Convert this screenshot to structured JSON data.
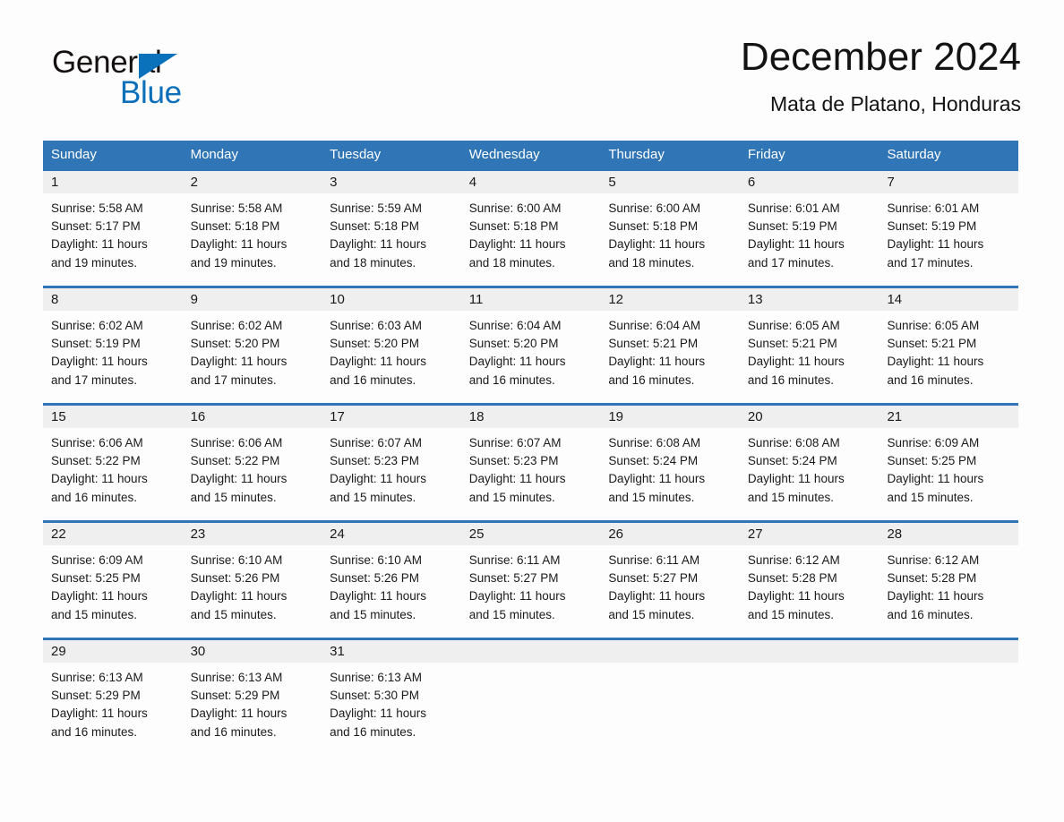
{
  "brand": {
    "name_part1": "General",
    "name_part2": "Blue",
    "logo_icon": "triangle-flag-icon",
    "accent_color": "#0b6fba"
  },
  "header": {
    "title": "December 2024",
    "subtitle": "Mata de Platano, Honduras"
  },
  "theme": {
    "header_bar_color": "#3075b5",
    "day_band_color": "#efefef",
    "page_background": "#fdfdfd"
  },
  "weekdays": [
    "Sunday",
    "Monday",
    "Tuesday",
    "Wednesday",
    "Thursday",
    "Friday",
    "Saturday"
  ],
  "weeks": [
    [
      {
        "day": "1",
        "sunrise": "Sunrise: 5:58 AM",
        "sunset": "Sunset: 5:17 PM",
        "daylight1": "Daylight: 11 hours",
        "daylight2": "and 19 minutes."
      },
      {
        "day": "2",
        "sunrise": "Sunrise: 5:58 AM",
        "sunset": "Sunset: 5:18 PM",
        "daylight1": "Daylight: 11 hours",
        "daylight2": "and 19 minutes."
      },
      {
        "day": "3",
        "sunrise": "Sunrise: 5:59 AM",
        "sunset": "Sunset: 5:18 PM",
        "daylight1": "Daylight: 11 hours",
        "daylight2": "and 18 minutes."
      },
      {
        "day": "4",
        "sunrise": "Sunrise: 6:00 AM",
        "sunset": "Sunset: 5:18 PM",
        "daylight1": "Daylight: 11 hours",
        "daylight2": "and 18 minutes."
      },
      {
        "day": "5",
        "sunrise": "Sunrise: 6:00 AM",
        "sunset": "Sunset: 5:18 PM",
        "daylight1": "Daylight: 11 hours",
        "daylight2": "and 18 minutes."
      },
      {
        "day": "6",
        "sunrise": "Sunrise: 6:01 AM",
        "sunset": "Sunset: 5:19 PM",
        "daylight1": "Daylight: 11 hours",
        "daylight2": "and 17 minutes."
      },
      {
        "day": "7",
        "sunrise": "Sunrise: 6:01 AM",
        "sunset": "Sunset: 5:19 PM",
        "daylight1": "Daylight: 11 hours",
        "daylight2": "and 17 minutes."
      }
    ],
    [
      {
        "day": "8",
        "sunrise": "Sunrise: 6:02 AM",
        "sunset": "Sunset: 5:19 PM",
        "daylight1": "Daylight: 11 hours",
        "daylight2": "and 17 minutes."
      },
      {
        "day": "9",
        "sunrise": "Sunrise: 6:02 AM",
        "sunset": "Sunset: 5:20 PM",
        "daylight1": "Daylight: 11 hours",
        "daylight2": "and 17 minutes."
      },
      {
        "day": "10",
        "sunrise": "Sunrise: 6:03 AM",
        "sunset": "Sunset: 5:20 PM",
        "daylight1": "Daylight: 11 hours",
        "daylight2": "and 16 minutes."
      },
      {
        "day": "11",
        "sunrise": "Sunrise: 6:04 AM",
        "sunset": "Sunset: 5:20 PM",
        "daylight1": "Daylight: 11 hours",
        "daylight2": "and 16 minutes."
      },
      {
        "day": "12",
        "sunrise": "Sunrise: 6:04 AM",
        "sunset": "Sunset: 5:21 PM",
        "daylight1": "Daylight: 11 hours",
        "daylight2": "and 16 minutes."
      },
      {
        "day": "13",
        "sunrise": "Sunrise: 6:05 AM",
        "sunset": "Sunset: 5:21 PM",
        "daylight1": "Daylight: 11 hours",
        "daylight2": "and 16 minutes."
      },
      {
        "day": "14",
        "sunrise": "Sunrise: 6:05 AM",
        "sunset": "Sunset: 5:21 PM",
        "daylight1": "Daylight: 11 hours",
        "daylight2": "and 16 minutes."
      }
    ],
    [
      {
        "day": "15",
        "sunrise": "Sunrise: 6:06 AM",
        "sunset": "Sunset: 5:22 PM",
        "daylight1": "Daylight: 11 hours",
        "daylight2": "and 16 minutes."
      },
      {
        "day": "16",
        "sunrise": "Sunrise: 6:06 AM",
        "sunset": "Sunset: 5:22 PM",
        "daylight1": "Daylight: 11 hours",
        "daylight2": "and 15 minutes."
      },
      {
        "day": "17",
        "sunrise": "Sunrise: 6:07 AM",
        "sunset": "Sunset: 5:23 PM",
        "daylight1": "Daylight: 11 hours",
        "daylight2": "and 15 minutes."
      },
      {
        "day": "18",
        "sunrise": "Sunrise: 6:07 AM",
        "sunset": "Sunset: 5:23 PM",
        "daylight1": "Daylight: 11 hours",
        "daylight2": "and 15 minutes."
      },
      {
        "day": "19",
        "sunrise": "Sunrise: 6:08 AM",
        "sunset": "Sunset: 5:24 PM",
        "daylight1": "Daylight: 11 hours",
        "daylight2": "and 15 minutes."
      },
      {
        "day": "20",
        "sunrise": "Sunrise: 6:08 AM",
        "sunset": "Sunset: 5:24 PM",
        "daylight1": "Daylight: 11 hours",
        "daylight2": "and 15 minutes."
      },
      {
        "day": "21",
        "sunrise": "Sunrise: 6:09 AM",
        "sunset": "Sunset: 5:25 PM",
        "daylight1": "Daylight: 11 hours",
        "daylight2": "and 15 minutes."
      }
    ],
    [
      {
        "day": "22",
        "sunrise": "Sunrise: 6:09 AM",
        "sunset": "Sunset: 5:25 PM",
        "daylight1": "Daylight: 11 hours",
        "daylight2": "and 15 minutes."
      },
      {
        "day": "23",
        "sunrise": "Sunrise: 6:10 AM",
        "sunset": "Sunset: 5:26 PM",
        "daylight1": "Daylight: 11 hours",
        "daylight2": "and 15 minutes."
      },
      {
        "day": "24",
        "sunrise": "Sunrise: 6:10 AM",
        "sunset": "Sunset: 5:26 PM",
        "daylight1": "Daylight: 11 hours",
        "daylight2": "and 15 minutes."
      },
      {
        "day": "25",
        "sunrise": "Sunrise: 6:11 AM",
        "sunset": "Sunset: 5:27 PM",
        "daylight1": "Daylight: 11 hours",
        "daylight2": "and 15 minutes."
      },
      {
        "day": "26",
        "sunrise": "Sunrise: 6:11 AM",
        "sunset": "Sunset: 5:27 PM",
        "daylight1": "Daylight: 11 hours",
        "daylight2": "and 15 minutes."
      },
      {
        "day": "27",
        "sunrise": "Sunrise: 6:12 AM",
        "sunset": "Sunset: 5:28 PM",
        "daylight1": "Daylight: 11 hours",
        "daylight2": "and 15 minutes."
      },
      {
        "day": "28",
        "sunrise": "Sunrise: 6:12 AM",
        "sunset": "Sunset: 5:28 PM",
        "daylight1": "Daylight: 11 hours",
        "daylight2": "and 16 minutes."
      }
    ],
    [
      {
        "day": "29",
        "sunrise": "Sunrise: 6:13 AM",
        "sunset": "Sunset: 5:29 PM",
        "daylight1": "Daylight: 11 hours",
        "daylight2": "and 16 minutes."
      },
      {
        "day": "30",
        "sunrise": "Sunrise: 6:13 AM",
        "sunset": "Sunset: 5:29 PM",
        "daylight1": "Daylight: 11 hours",
        "daylight2": "and 16 minutes."
      },
      {
        "day": "31",
        "sunrise": "Sunrise: 6:13 AM",
        "sunset": "Sunset: 5:30 PM",
        "daylight1": "Daylight: 11 hours",
        "daylight2": "and 16 minutes."
      },
      {
        "day": "",
        "sunrise": "",
        "sunset": "",
        "daylight1": "",
        "daylight2": ""
      },
      {
        "day": "",
        "sunrise": "",
        "sunset": "",
        "daylight1": "",
        "daylight2": ""
      },
      {
        "day": "",
        "sunrise": "",
        "sunset": "",
        "daylight1": "",
        "daylight2": ""
      },
      {
        "day": "",
        "sunrise": "",
        "sunset": "",
        "daylight1": "",
        "daylight2": ""
      }
    ]
  ]
}
